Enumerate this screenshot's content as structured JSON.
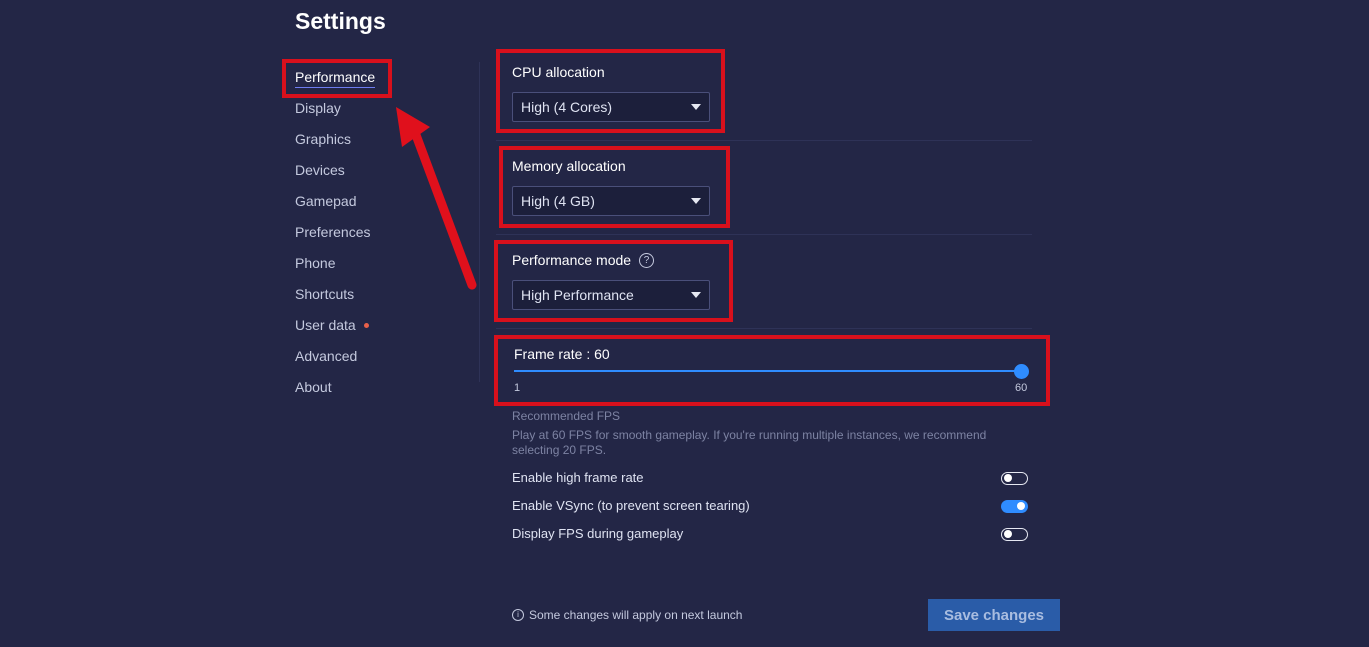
{
  "page": {
    "title": "Settings"
  },
  "sidebar": {
    "items": [
      {
        "label": "Performance",
        "active": true
      },
      {
        "label": "Display"
      },
      {
        "label": "Graphics"
      },
      {
        "label": "Devices"
      },
      {
        "label": "Gamepad"
      },
      {
        "label": "Preferences"
      },
      {
        "label": "Phone"
      },
      {
        "label": "Shortcuts"
      },
      {
        "label": "User data",
        "badge_color": "#e8604a"
      },
      {
        "label": "Advanced"
      },
      {
        "label": "About"
      }
    ]
  },
  "performance": {
    "cpu": {
      "label": "CPU allocation",
      "value": "High (4 Cores)"
    },
    "memory": {
      "label": "Memory allocation",
      "value": "High (4 GB)"
    },
    "mode": {
      "label": "Performance mode",
      "value": "High Performance",
      "help_icon": "question-circle-icon"
    },
    "frame_rate": {
      "label": "Frame rate : 60",
      "min_label": "1",
      "max_label": "60",
      "min": 1,
      "max": 60,
      "value": 60
    },
    "recommended": {
      "heading": "Recommended FPS",
      "text": "Play at 60 FPS for smooth gameplay. If you're running multiple instances, we recommend selecting 20 FPS."
    },
    "toggles": [
      {
        "label": "Enable high frame rate",
        "on": false
      },
      {
        "label": "Enable VSync (to prevent screen tearing)",
        "on": true
      },
      {
        "label": "Display FPS during gameplay",
        "on": false
      }
    ]
  },
  "footer": {
    "note": "Some changes will apply on next launch",
    "note_icon": "info-icon",
    "save_label": "Save changes"
  },
  "colors": {
    "background": "#232646",
    "accent": "#2f8cff",
    "highlight_box": "#d8101c",
    "save_button": "#2a5ca8"
  }
}
